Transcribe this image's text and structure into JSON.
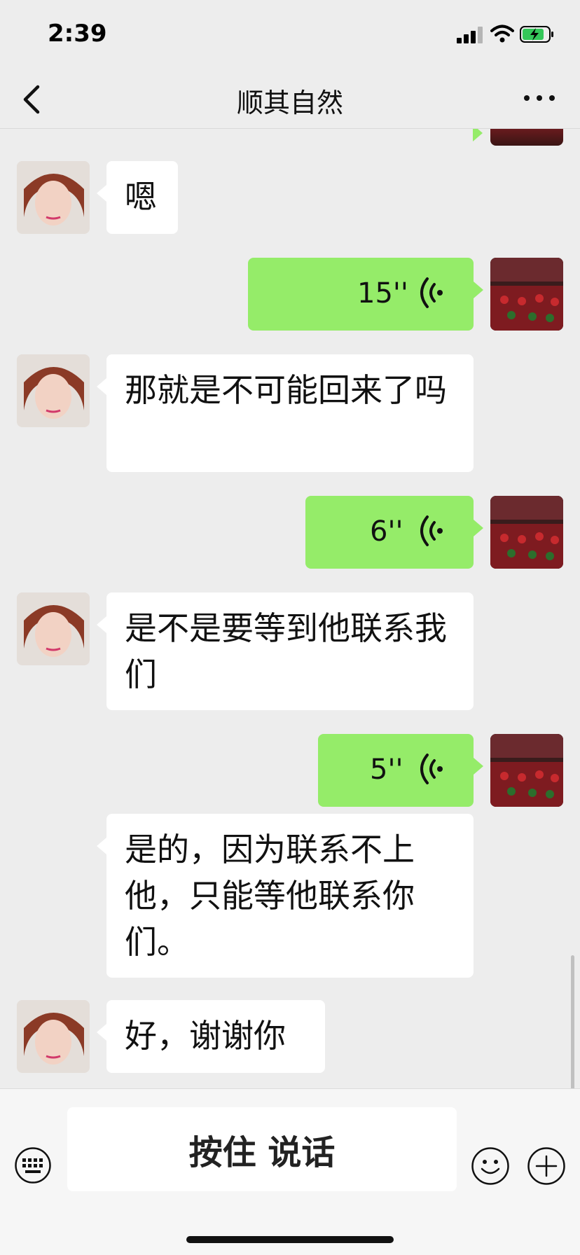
{
  "status": {
    "time": "2:39",
    "icons": [
      "cellular-signal-icon",
      "wifi-icon",
      "battery-charging-icon"
    ]
  },
  "header": {
    "back_icon": "chevron-left-icon",
    "title": "顺其自然",
    "more_icon": "more-dots-icon"
  },
  "messages": [
    {
      "side": "left",
      "type": "text",
      "text": "嗯"
    },
    {
      "side": "right",
      "type": "voice",
      "duration": "15''"
    },
    {
      "side": "left",
      "type": "text",
      "text": "那就是不可能回来了吗"
    },
    {
      "side": "right",
      "type": "voice",
      "duration": "6''"
    },
    {
      "side": "left",
      "type": "text",
      "text": "是不是要等到他联系我们"
    },
    {
      "side": "right",
      "type": "voice",
      "duration": "5''"
    },
    {
      "side": "left",
      "type": "text",
      "text": "是的，因为联系不上他，只能等他联系你们。"
    },
    {
      "side": "left",
      "type": "text",
      "text": "好，谢谢你"
    }
  ],
  "input_bar": {
    "keyboard_icon": "keyboard-icon",
    "hold_to_talk_label": "按住 说话",
    "emoji_icon": "emoji-icon",
    "plus_icon": "plus-circle-icon"
  },
  "colors": {
    "background": "#ededed",
    "bubble_self": "#95ec69",
    "bubble_other": "#ffffff"
  }
}
